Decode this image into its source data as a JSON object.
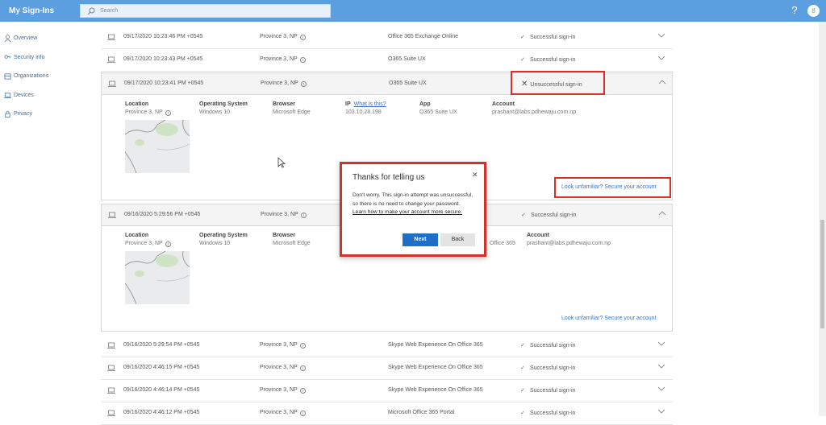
{
  "header": {
    "app_title": "My Sign-Ins",
    "search_placeholder": "Search",
    "help_label": "?",
    "avatar_label": "8"
  },
  "sidebar": {
    "items": [
      {
        "label": "Overview",
        "icon": "person-icon"
      },
      {
        "label": "Security info",
        "icon": "key-icon"
      },
      {
        "label": "Organizations",
        "icon": "organization-icon"
      },
      {
        "label": "Devices",
        "icon": "laptop-icon"
      },
      {
        "label": "Privacy",
        "icon": "lock-icon"
      }
    ]
  },
  "rows": [
    {
      "date": "09/17/2020 10:23:46 PM +0545",
      "location": "Province 3, NP",
      "app": "Office 365 Exchange Online",
      "status": "Successful sign-in"
    },
    {
      "date": "09/17/2020 10:23:43 PM +0545",
      "location": "Province 3, NP",
      "app": "O365 Suite UX",
      "status": "Successful sign-in"
    },
    {
      "date": "09/17/2020 10:23:41 PM +0545",
      "location": "Province 3, NP",
      "app": "O365 Suite UX",
      "status": "Unsuccessful sign-in"
    },
    {
      "date": "09/16/2020 5:29:56 PM +0545",
      "location": "Province 3, NP",
      "app": "",
      "status": "Successful sign-in"
    },
    {
      "date": "09/16/2020 5:29:54 PM +0545",
      "location": "Province 3, NP",
      "app": "Skype Web Experience On Office 365",
      "status": "Successful sign-in"
    },
    {
      "date": "09/16/2020 4:46:15 PM +0545",
      "location": "Province 3, NP",
      "app": "Skype Web Experience On Office 365",
      "status": "Successful sign-in"
    },
    {
      "date": "09/16/2020 4:46:14 PM +0545",
      "location": "Province 3, NP",
      "app": "Skype Web Experience On Office 365",
      "status": "Successful sign-in"
    },
    {
      "date": "09/16/2020 4:46:12 PM +0545",
      "location": "Province 3, NP",
      "app": "Microsoft Office 365 Portal",
      "status": "Successful sign-in"
    }
  ],
  "details1": {
    "location_label": "Location",
    "location": "Province 3, NP",
    "os_label": "Operating System",
    "os": "Windows 10",
    "browser_label": "Browser",
    "browser": "Microsoft Edge",
    "ip_label": "IP",
    "ip_help": "What is this?",
    "ip": "103.10.28.198",
    "app_label": "App",
    "app": "O365 Suite UX",
    "account_label": "Account",
    "account": "prashant@labs.pdhewaju.com.np",
    "secure_link": "Look unfamiliar? Secure your account"
  },
  "details2": {
    "location_label": "Location",
    "location": "Province 3, NP",
    "os_label": "Operating System",
    "os": "Windows 10",
    "browser_label": "Browser",
    "browser": "Microsoft Edge",
    "app_partial": "Office 365",
    "account_label": "Account",
    "account": "prashant@labs.pdhewaju.com.np",
    "secure_link": "Look unfamiliar? Secure your account"
  },
  "dialog": {
    "title": "Thanks for telling us",
    "close": "✕",
    "body": "Don't worry. This sign-in attempt was unsuccessful, so there is no need to change your password.",
    "link": "Learn how to make your account more secure.",
    "next_label": "Next",
    "back_label": "Back"
  },
  "colors": {
    "header_bg": "#5c9fe0",
    "accent": "#1f6fc8",
    "highlight": "#d6302b"
  }
}
